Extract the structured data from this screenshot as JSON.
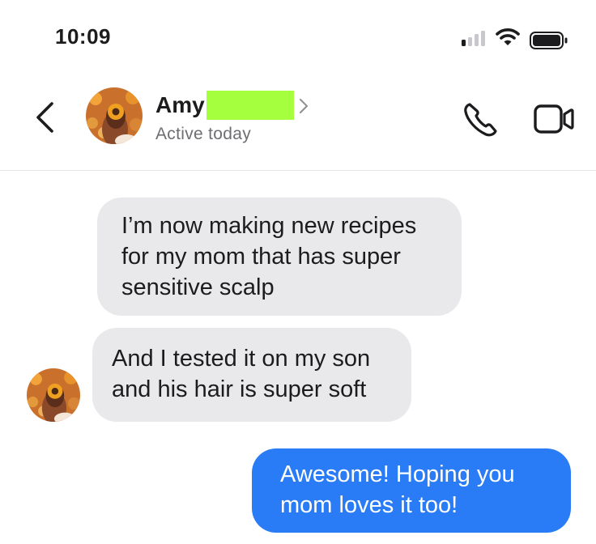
{
  "status_bar": {
    "time": "10:09",
    "icons": [
      "signal-icon",
      "wifi-icon",
      "battery-icon"
    ]
  },
  "header": {
    "back_icon": "chevron-left-icon",
    "contact_name": "Amy",
    "status": "Active today",
    "actions": [
      "phone-icon",
      "video-camera-icon"
    ]
  },
  "messages": [
    {
      "direction": "incoming",
      "lines": [
        "I’m now making new recipes",
        "for my mom that has super",
        "sensitive scalp"
      ]
    },
    {
      "direction": "incoming",
      "lines": [
        "And I tested it on my son",
        "and his hair is super soft"
      ]
    },
    {
      "direction": "outgoing",
      "lines": [
        "Awesome! Hoping you",
        "mom loves it too!"
      ]
    }
  ],
  "colors": {
    "outgoing_bubble": "#2a7cf6",
    "incoming_bubble": "#e9e9eb",
    "redaction": "#a6ff3e"
  }
}
